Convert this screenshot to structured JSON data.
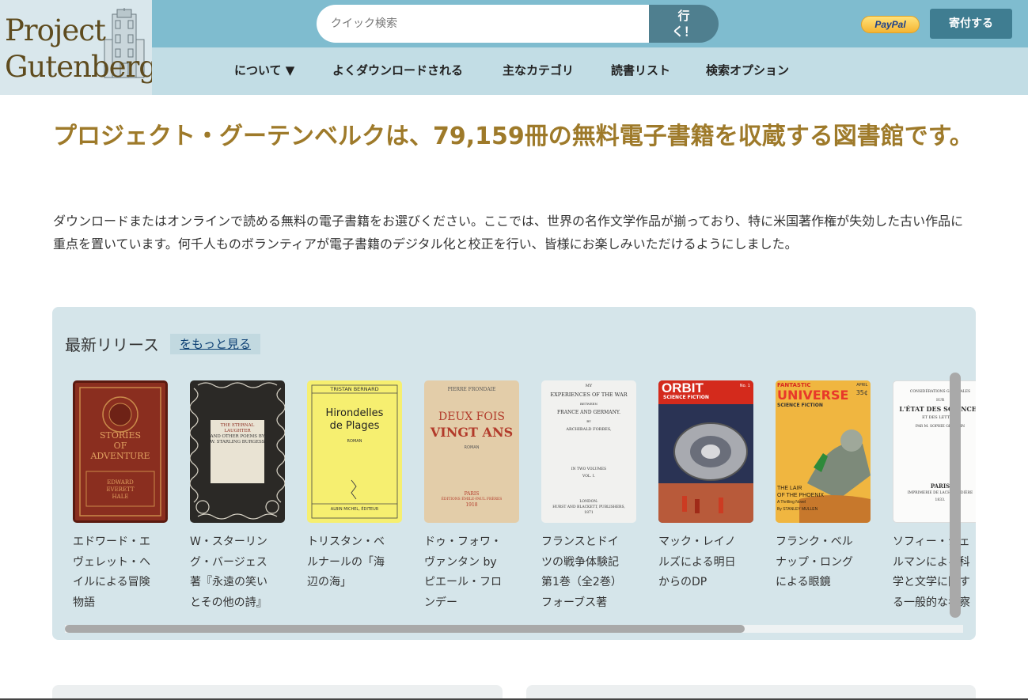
{
  "logo": {
    "line1": "Project",
    "line2": "Gutenberg"
  },
  "search": {
    "placeholder": "クイック検索",
    "button_line1": "行",
    "button_line2": "く！"
  },
  "paypal_label": "PayPal",
  "donate_label": "寄付する",
  "nav": {
    "about": "について ▼",
    "frequently_downloaded": "よくダウンロードされる",
    "main_categories": "主なカテゴリ",
    "reading_lists": "読書リスト",
    "search_options": "検索オプション"
  },
  "headline": "プロジェクト・グーテンベルクは、79,159冊の無料電子書籍を収蔵する図書館です。",
  "intro": "ダウンロードまたはオンラインで読める無料の電子書籍をお選びください。ここでは、世界の名作文学作品が揃っており、特に米国著作権が失効した古い作品に重点を置いています。何千人ものボランティアが電子書籍のデジタル化と校正を行い、皆様にお楽しみいただけるようにしました。",
  "latest": {
    "title": "最新リリース",
    "more": "をもっと見る",
    "books": [
      {
        "title": "エドワード・エヴェレット・ヘイルによる冒険物語",
        "cover_lines": [
          "STORIES",
          "OF",
          "ADVENTURE",
          "EDWARD",
          "EVERETT",
          "HALE"
        ]
      },
      {
        "title": "W・スターリング・バージェス著『永遠の笑いとその他の詩』",
        "cover_lines": [
          "THE ETERNAL",
          "LAUGHTER",
          "AND OTHER POEMS BY",
          "W. STARLING BURGESS"
        ]
      },
      {
        "title": "トリスタン・ベルナールの「海辺の海」",
        "cover_lines": [
          "TRISTAN BERNARD",
          "Hirondelles",
          "de Plages",
          "ROMAN",
          "ALBIN MICHEL, ÉDITEUR"
        ]
      },
      {
        "title": "ドゥ・フォワ・ヴァンタン by ピエール・フロンデー",
        "cover_lines": [
          "PIERRE FRONDAIE",
          "DEUX FOIS",
          "VINGT ANS",
          "ROMAN",
          "PARIS",
          "ÉDITIONS ÉMILE-PAUL FRÈRES",
          "1918"
        ]
      },
      {
        "title": "フランスとドイツの戦争体験記 第1巻（全2巻）フォーブス著",
        "cover_lines": [
          "MY",
          "EXPERIENCES OF THE WAR",
          "BETWEEN",
          "FRANCE AND GERMANY.",
          "BY",
          "ARCHIBALD FORBES,",
          "IN TWO VOLUMES",
          "VOL. I.",
          "LONDON:",
          "HURST AND BLACKETT, PUBLISHERS,",
          "1871"
        ]
      },
      {
        "title": "マック・レイノルズによる明日からのDP",
        "cover_lines": [
          "ORBIT",
          "SCIENCE FICTION",
          "No. 1"
        ]
      },
      {
        "title": "フランク・ベルナップ・ロングによる眼鏡",
        "cover_lines": [
          "FANTASTIC",
          "UNIVERSE",
          "SCIENCE FICTION",
          "APRIL",
          "35¢",
          "THE LAIR",
          "OF THE PHOENIX",
          "A Thrilling Novel",
          "By STANLEY MULLEN"
        ]
      },
      {
        "title": "ソフィー・ジェルマンによる科学と文学に関する一般的な考察",
        "cover_lines": [
          "CONSIDÉRATIONS GÉNÉRALES",
          "SUR",
          "L'ÉTAT DES SCIENCES",
          "ET DES LETTRES",
          "PAR M. SOPHIE GERMAIN",
          "PARIS",
          "IMPRIMERIE DE LACHEVARDIÈRE",
          "1833."
        ]
      }
    ]
  },
  "colors": {
    "topbar": "#7fbccf",
    "navbar": "#c2dde5",
    "headline": "#9e7a2a",
    "panel": "#d5e5ea",
    "donate": "#3f7d91"
  }
}
